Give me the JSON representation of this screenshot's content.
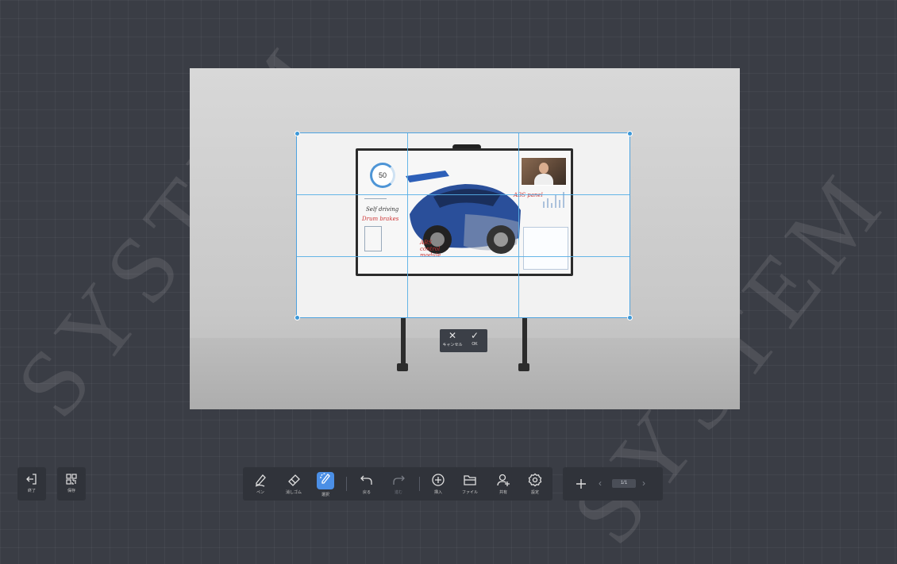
{
  "watermark": {
    "text1": "SYSTEM",
    "text2": "SYSTEM"
  },
  "screen": {
    "labels": {
      "gauge": "50",
      "label1": "ABS panel",
      "label2": "Drum brakes",
      "label3": "ABS control module",
      "label4": "Self driving"
    }
  },
  "confirm": {
    "cancel_label": "キャンセル",
    "ok_label": "OK"
  },
  "toolbar": {
    "exit_label": "終了",
    "save_label": "保存",
    "pen_label": "ペン",
    "eraser_label": "消しゴム",
    "select_label": "選択",
    "undo_label": "戻る",
    "redo_label": "進む",
    "insert_label": "挿入",
    "file_label": "ファイル",
    "share_label": "共有",
    "settings_label": "設定",
    "page_indicator": "1/1"
  },
  "icons": {
    "exit": "exit-icon",
    "save": "qr-icon",
    "pen": "pen-icon",
    "eraser": "eraser-icon",
    "select": "lasso-select-icon",
    "undo": "undo-icon",
    "redo": "redo-icon",
    "insert": "plus-circle-icon",
    "file": "folder-icon",
    "share": "add-user-icon",
    "settings": "gear-icon",
    "add_page": "plus-icon",
    "prev": "chevron-left-icon",
    "next": "chevron-right-icon",
    "cancel": "close-icon",
    "ok": "check-icon"
  },
  "colors": {
    "background": "#3a3d45",
    "toolbar": "#30333a",
    "accent": "#4b8fe6",
    "crop_line": "#55aee6"
  }
}
